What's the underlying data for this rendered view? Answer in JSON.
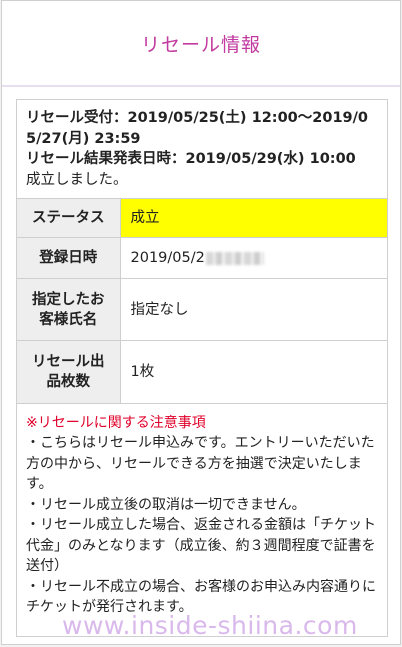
{
  "colors": {
    "accent": "#c23ba0",
    "highlight": "#ffff00",
    "notice": "#e0002a",
    "watermark": "#cfa5e6"
  },
  "header": {
    "title": "リセール情報"
  },
  "info": {
    "accept_period": "リセール受付：2019/05/25(土) 12:00〜2019/05/27(月) 23:59",
    "result_date": "リセール結果発表日時：2019/05/29(水) 10:00",
    "result_message": "成立しました。"
  },
  "table": {
    "rows": [
      {
        "label": "ステータス",
        "value": "成立"
      },
      {
        "label": "登録日時",
        "value": "2019/05/2"
      },
      {
        "label": "指定したお客様氏名",
        "value": "指定なし"
      },
      {
        "label": "リセール出品枚数",
        "value": "1枚"
      }
    ]
  },
  "notes": {
    "title": "※リセールに関する注意事項",
    "items": [
      "・こちらはリセール申込みです。エントリーいただいた方の中から、リセールできる方を抽選で決定いたします。",
      "・リセール成立後の取消は一切できません。",
      "・リセール成立した場合、返金される金額は「チケット代金」のみとなります（成立後、約３週間程度で証書を送付）",
      "・リセール不成立の場合、お客様のお申込み内容通りにチケットが発行されます。"
    ]
  },
  "watermark": {
    "text": "www.inside-shiina.com"
  }
}
